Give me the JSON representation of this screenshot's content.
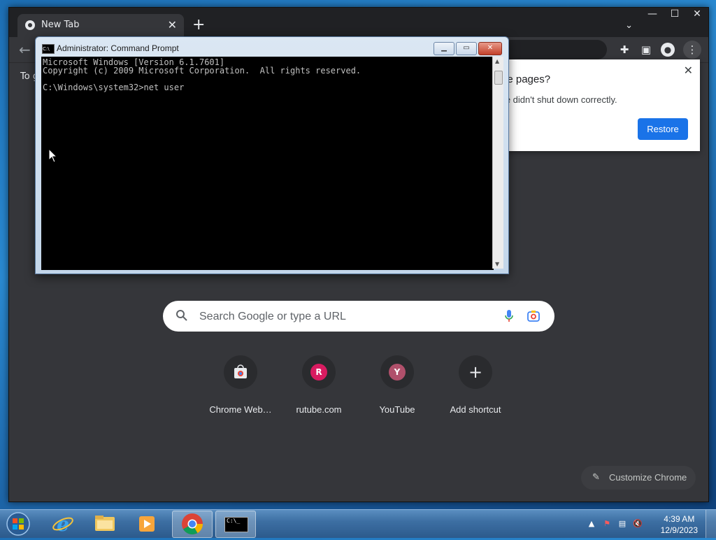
{
  "chrome": {
    "tab_title": "New Tab",
    "infobar_text": "To g",
    "search": {
      "placeholder": "Search Google or type a URL"
    },
    "shortcuts": [
      {
        "label": "Chrome Web…",
        "letter": "",
        "color": ""
      },
      {
        "label": "rutube.com",
        "letter": "R",
        "color": "#d81b60"
      },
      {
        "label": "YouTube",
        "letter": "Y",
        "color": "#b0506b"
      },
      {
        "label": "Add shortcut",
        "letter": "+",
        "color": ""
      }
    ],
    "customize_label": "Customize Chrome",
    "restore_popup": {
      "title": "ore pages?",
      "message": "me didn't shut down correctly.",
      "button": "Restore"
    }
  },
  "cmd": {
    "title": "Administrator:  Command Prompt",
    "icon_text": "C:\\",
    "lines": [
      "Microsoft Windows [Version 6.1.7601]",
      "Copyright (c) 2009 Microsoft Corporation.  All rights reserved.",
      "",
      "C:\\Windows\\system32>net user"
    ]
  },
  "taskbar": {
    "time": "4:39 AM",
    "date": "12/9/2023",
    "cmd_icon_text": "C:\\_"
  },
  "colors": {
    "accent": "#1a73e8",
    "chrome_bg": "#35363a"
  }
}
